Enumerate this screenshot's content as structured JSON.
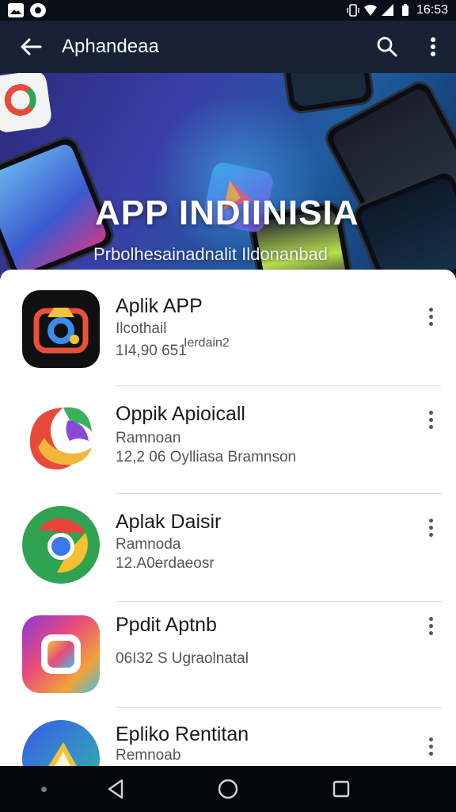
{
  "status_bar": {
    "time": "16:53",
    "icons": [
      "image-icon",
      "app-icon",
      "vibrate-icon",
      "wifi-icon",
      "signal-icon",
      "battery-icon"
    ]
  },
  "app_bar": {
    "title": "Aphandeaa",
    "back_icon": "arrow-left-icon",
    "search_icon": "search-icon",
    "menu_icon": "more-vert-icon"
  },
  "banner": {
    "title": "APP INDIINISIA",
    "subtitle": "Prbolhesainadnalit Ildonanbad",
    "dots": 3,
    "active_dot": 1
  },
  "apps": [
    {
      "name": "Aplik APP",
      "developer": "Ilcothail",
      "downloads": "1I4,90 651",
      "extra": "Ierdain2",
      "icon": "camera-app-icon",
      "colors": [
        "#111111",
        "#e8503a",
        "#f2c23a",
        "#3a8de8"
      ]
    },
    {
      "name": "Oppik Apioicall",
      "developer": "Ramnoan",
      "downloads": "12,2 06 Oylliasa Bramnson",
      "icon": "bird-app-icon",
      "colors": [
        "#e84a3a",
        "#f2b63a",
        "#8a4ad8",
        "#38b25a"
      ]
    },
    {
      "name": "Aplak Daisir",
      "developer": "Ramnoda",
      "downloads": "12.A0erdaeosr",
      "icon": "browser-app-icon",
      "colors": [
        "#2fa352",
        "#e8453a",
        "#f5c02e",
        "#3a78e8"
      ]
    },
    {
      "name": "Ppdit Aptnb",
      "developer": "",
      "downloads": "06I32 S Ugraolnatal",
      "icon": "gallery-app-icon",
      "colors": [
        "#8a3ad8",
        "#e84a7a",
        "#f2a23a",
        "#3ac4e8"
      ]
    },
    {
      "name": "Epliko Rentitan",
      "developer": "Remnoab",
      "downloads": "",
      "icon": "play-app-icon",
      "colors": [
        "#3a5ae8",
        "#2fb8a8",
        "#f2c23a"
      ]
    }
  ],
  "nav_bar": {
    "back": "back-triangle-icon",
    "home": "home-circle-icon",
    "recents": "recents-square-icon"
  }
}
